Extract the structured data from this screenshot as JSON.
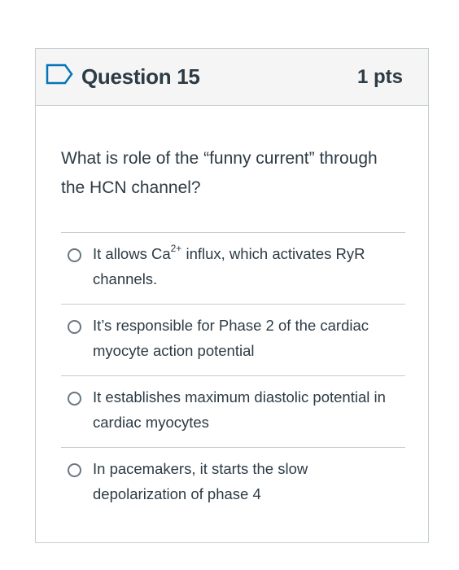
{
  "question": {
    "title": "Question 15",
    "points": "1 pts",
    "text": "What is role of the “funny current” through the HCN channel?"
  },
  "answers": [
    {
      "text_before_sup": "It allows Ca",
      "sup": "2+",
      "text_after_sup": " influx, which activates RyR channels.",
      "selected": false
    },
    {
      "text": "It’s responsible for Phase 2 of the cardiac myocyte action potential",
      "selected": false
    },
    {
      "text": "It establishes maximum diastolic potential in cardiac myocytes",
      "selected": false
    },
    {
      "text": "In pacemakers, it starts the slow depolarization of phase 4",
      "selected": false
    }
  ],
  "colors": {
    "header_bg": "#f5f5f5",
    "border": "#c7cdd1",
    "text": "#2d3b45",
    "flag_icon": "#0374b5"
  },
  "icons": {
    "flag": "flag-question-icon",
    "radio": "radio-unchecked-icon"
  }
}
